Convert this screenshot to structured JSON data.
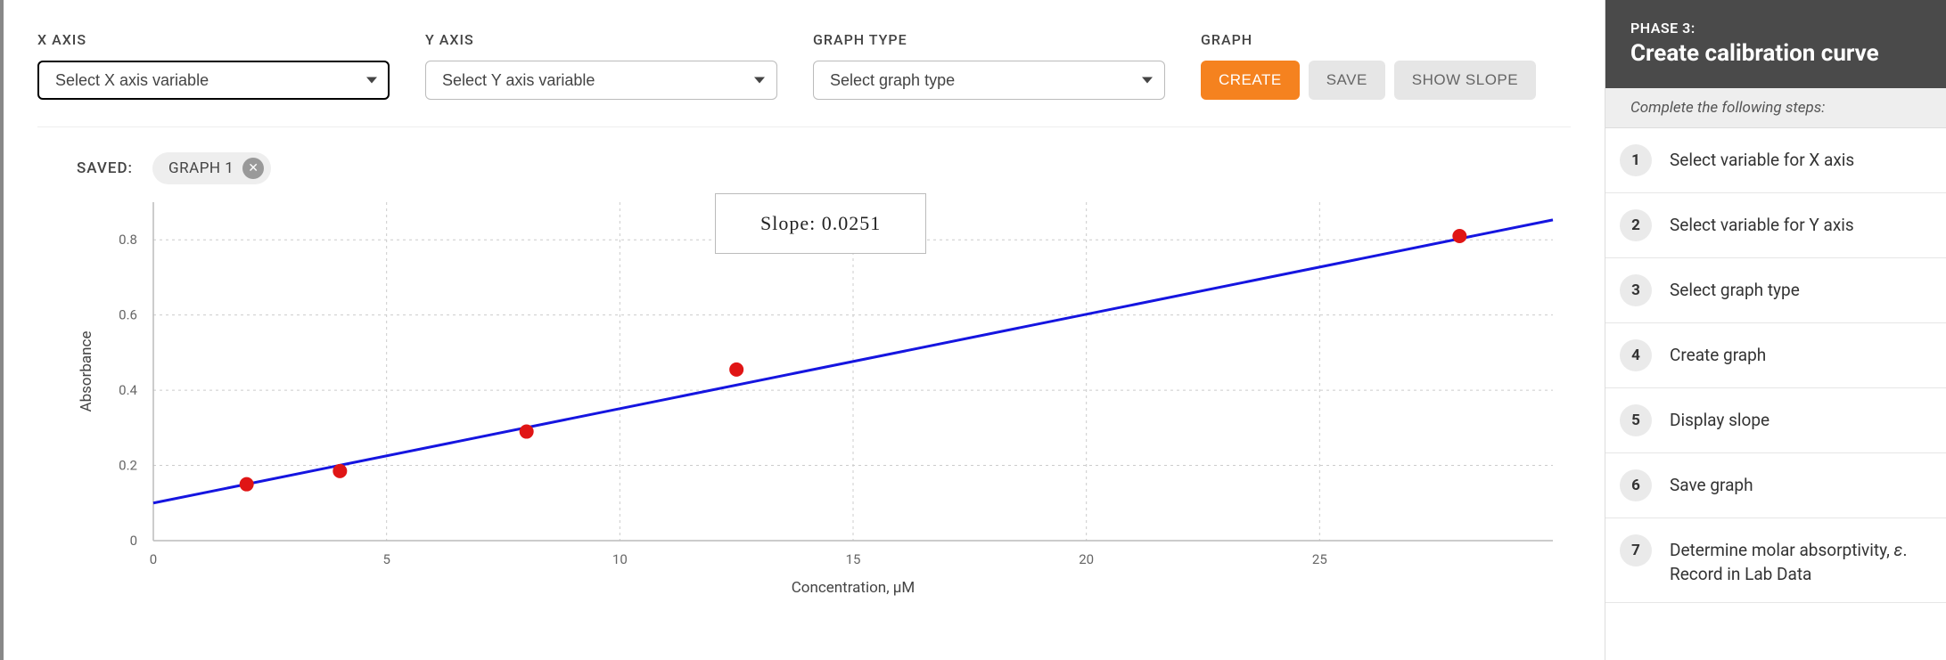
{
  "controls": {
    "x_label": "X AXIS",
    "y_label": "Y AXIS",
    "type_label": "GRAPH TYPE",
    "graph_label": "GRAPH",
    "x_placeholder": "Select X axis variable",
    "y_placeholder": "Select Y axis variable",
    "type_placeholder": "Select graph type",
    "create": "CREATE",
    "save": "SAVE",
    "show_slope": "SHOW SLOPE"
  },
  "saved": {
    "label": "SAVED:",
    "chip_label": "GRAPH 1"
  },
  "slope_box": "Slope: 0.0251",
  "chart_data": {
    "type": "scatter",
    "title": "",
    "xlabel": "Concentration, µM",
    "ylabel": "Absorbance",
    "xlim": [
      0,
      30
    ],
    "ylim": [
      0,
      0.9
    ],
    "x_ticks": [
      0,
      5,
      10,
      15,
      20,
      25
    ],
    "y_ticks": [
      0,
      0.2,
      0.4,
      0.6,
      0.8
    ],
    "points": [
      {
        "x": 2.0,
        "y": 0.15
      },
      {
        "x": 4.0,
        "y": 0.185
      },
      {
        "x": 8.0,
        "y": 0.29
      },
      {
        "x": 12.5,
        "y": 0.455
      },
      {
        "x": 28.0,
        "y": 0.81
      }
    ],
    "fit": {
      "slope": 0.0251,
      "intercept": 0.1,
      "x0": 0,
      "x1": 30
    }
  },
  "sidebar": {
    "kicker": "PHASE 3:",
    "title": "Create calibration curve",
    "subtitle": "Complete the following steps:",
    "steps": [
      {
        "n": "1",
        "text": "Select variable for X axis"
      },
      {
        "n": "2",
        "text": "Select variable for Y axis"
      },
      {
        "n": "3",
        "text": "Select graph type"
      },
      {
        "n": "4",
        "text": "Create graph"
      },
      {
        "n": "5",
        "text": "Display slope"
      },
      {
        "n": "6",
        "text": "Save graph"
      },
      {
        "n": "7",
        "text": "Determine molar absorptivity, ε. Record in Lab Data"
      }
    ]
  }
}
